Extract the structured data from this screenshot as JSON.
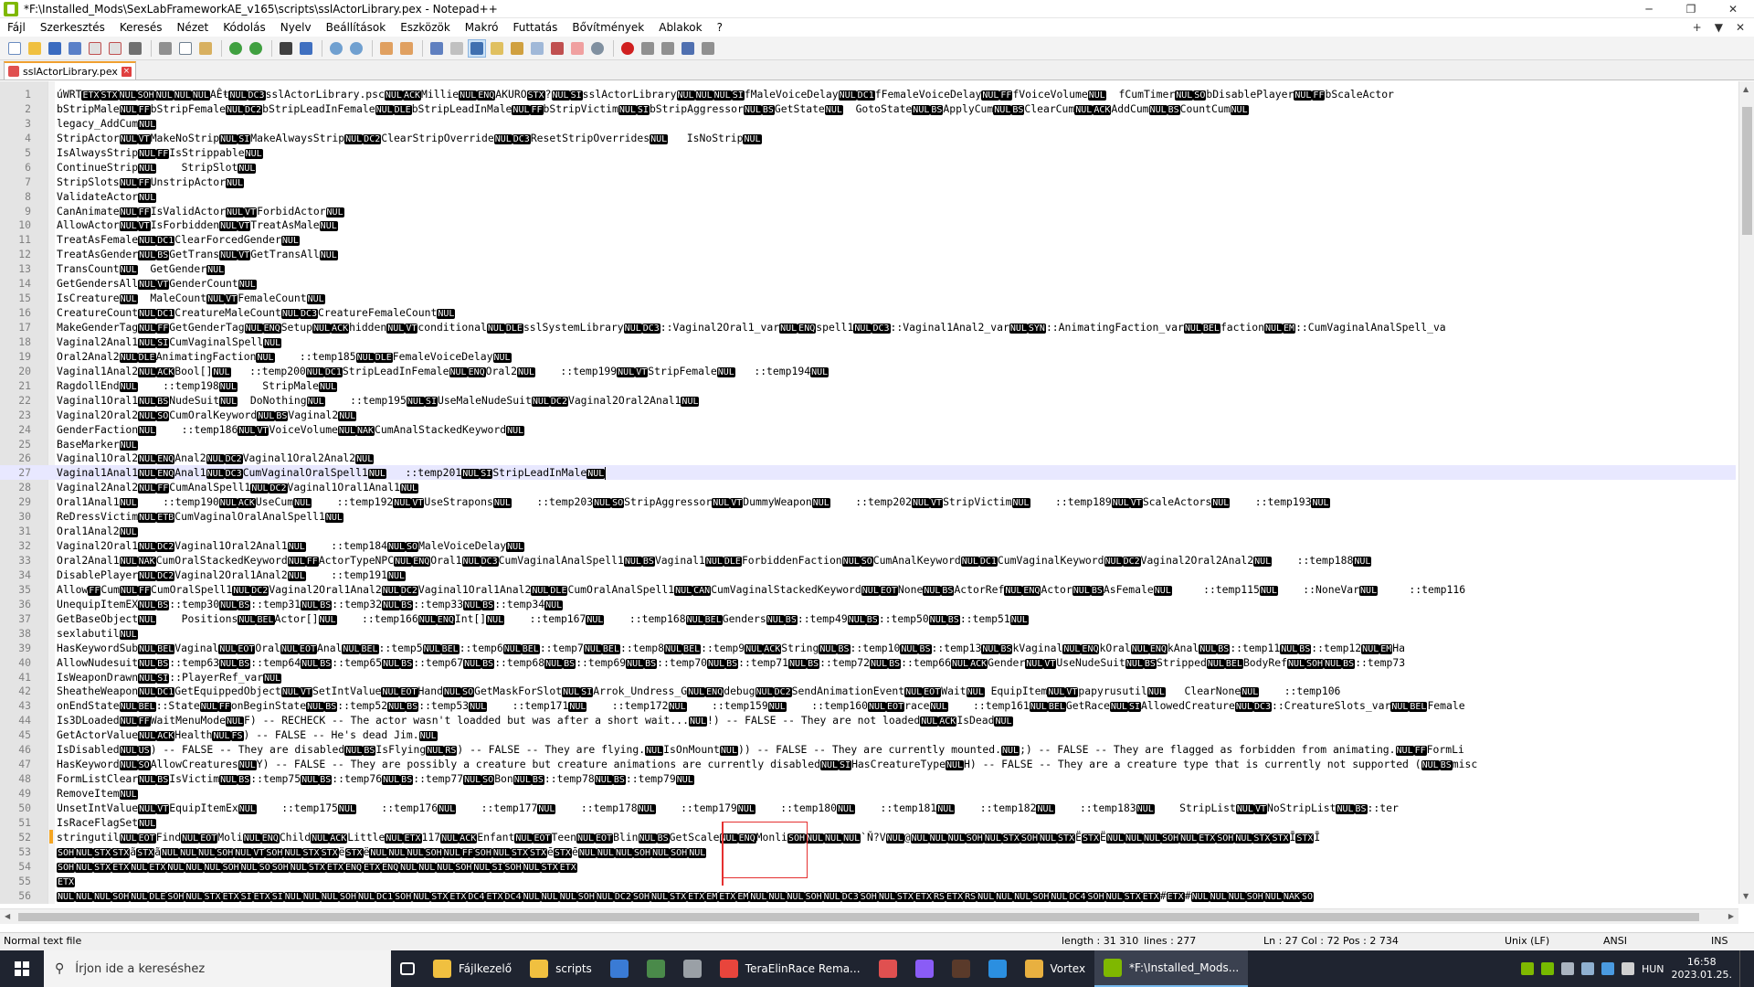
{
  "window": {
    "title": "*F:\\Installed_Mods\\SexLabFrameworkAE_v165\\scripts\\sslActorLibrary.pex - Notepad++",
    "controls": [
      "─",
      "❐",
      "✕"
    ]
  },
  "menu": {
    "items": [
      "Fájl",
      "Szerkesztés",
      "Keresés",
      "Nézet",
      "Kódolás",
      "Nyelv",
      "Beállítások",
      "Eszközök",
      "Makró",
      "Futtatás",
      "Bővítmények",
      "Ablakok",
      "?"
    ],
    "right": [
      "+",
      "▼",
      "✕"
    ]
  },
  "tab": {
    "label": "sslActorLibrary.pex",
    "close": "×"
  },
  "editor": {
    "lines": [
      {
        "n": "1",
        "t": "úWRTETXSTXNULSOHNULNULNULAÊŧNULDC3sslActorLibrary.pscNULACKMillieNULENQAKUROSTX?NULSIsslActorLibraryNULNULNULSIfMaleVoiceDelayNULDC1fFemaleVoiceDelayNULFFfVoiceVolumeNUL  fCumTimerNULSObDisablePlayerNULFFbScaleActor"
      },
      {
        "n": "2",
        "t": "bStripMaleNULFFbStripFemaleNULDC2bStripLeadInFemaleNULDLEbStripLeadInMaleNULFFbStripVictimNULSIbStripAggressorNULBSGetStateNUL  GotoStateNULBSApplyCumNULBSClearCumNULACKAddCumNULBSCountCumNUL"
      },
      {
        "n": "3",
        "t": "legacy_AddCumNUL"
      },
      {
        "n": "4",
        "t": "StripActorNULVTMakeNoStripNULSIMakeAlwaysStripNULDC2ClearStripOverrideNULDC3ResetStripOverridesNUL   IsNoStripNUL"
      },
      {
        "n": "5",
        "t": "IsAlwaysStripNULFFIsStrippableNUL"
      },
      {
        "n": "6",
        "t": "ContinueStripNUL    StripSlotNUL"
      },
      {
        "n": "7",
        "t": "StripSlotsNULFFUnstripActorNUL"
      },
      {
        "n": "8",
        "t": "ValidateActorNUL"
      },
      {
        "n": "9",
        "t": "CanAnimateNULFFIsValidActorNULVTForbidActorNUL"
      },
      {
        "n": "10",
        "t": "AllowActorNULVTIsForbiddenNULVTTreatAsMaleNUL"
      },
      {
        "n": "11",
        "t": "TreatAsFemaleNULDC1ClearForcedGenderNUL"
      },
      {
        "n": "12",
        "t": "TreatAsGenderNULBSGetTransNULVTGetTransAllNUL"
      },
      {
        "n": "13",
        "t": "TransCountNUL  GetGenderNUL"
      },
      {
        "n": "14",
        "t": "GetGendersAllNULVTGenderCountNUL"
      },
      {
        "n": "15",
        "t": "IsCreatureNUL  MaleCountNULVTFemaleCountNUL"
      },
      {
        "n": "16",
        "t": "CreatureCountNULDC1CreatureMaleCountNULDC3CreatureFemaleCountNUL"
      },
      {
        "n": "17",
        "t": "MakeGenderTagNULFFGetGenderTagNULENQSetupNULACKhiddenNULVTconditionalNULDLEsslSystemLibraryNULDC3::Vaginal2Oral1_varNULENQspell1NULDC3::Vaginal1Anal2_varNULSYN::AnimatingFaction_varNULBELfactionNULEM::CumVaginalAnalSpell_va"
      },
      {
        "n": "18",
        "t": "Vaginal2Anal1NULSICumVaginalSpellNUL"
      },
      {
        "n": "19",
        "t": "Oral2Anal2NULDLEAnimatingFactionNUL    ::temp185NULDLEFemaleVoiceDelayNUL"
      },
      {
        "n": "20",
        "t": "Vaginal1Anal2NULACKBool[]NUL   ::temp200NULDC1StripLeadInFemaleNULENQOral2NUL    ::temp199NULVTStripFemaleNUL   ::temp194NUL"
      },
      {
        "n": "21",
        "t": "RagdollEndNUL    ::temp198NUL    StripMaleNUL"
      },
      {
        "n": "22",
        "t": "Vaginal1Oral1NULBSNudeSuitNUL  DoNothingNUL    ::temp195NULSIUseMaleNudeSuitNULDC2Vaginal2Oral2Anal1NUL"
      },
      {
        "n": "23",
        "t": "Vaginal2Oral2NULSOCumOralKeywordNULBSVaginal2NUL"
      },
      {
        "n": "24",
        "t": "GenderFactionNUL    ::temp186NULVTVoiceVolumeNULNAKCumAnalStackedKeywordNUL"
      },
      {
        "n": "25",
        "t": "BaseMarkerNUL"
      },
      {
        "n": "26",
        "t": "Vaginal1Oral2NULENQAnal2NULDC2Vaginal1Oral2Anal2NUL"
      },
      {
        "n": "27",
        "t": "Vaginal1Anal1NULENQAnal1NULDC3CumVaginalOralSpell1NUL   ::temp201NULSIStripLeadInMaleNUL",
        "current": true
      },
      {
        "n": "28",
        "t": "Vaginal2Anal2NULFFCumAnalSpell1NULDC2Vaginal1Oral1Anal1NUL"
      },
      {
        "n": "29",
        "t": "Oral1Anal1NUL    ::temp190NULACKUseCumNUL    ::temp192NULVTUseStraponsNUL    ::temp203NULSOStripAggressorNULVTDummyWeaponNUL    ::temp202NULVTStripVictimNUL    ::temp189NULVTScaleActorsNUL    ::temp193NUL"
      },
      {
        "n": "30",
        "t": "ReDressVictimNULETBCumVaginalOralAnalSpell1NUL"
      },
      {
        "n": "31",
        "t": "Oral1Anal2NUL"
      },
      {
        "n": "32",
        "t": "Vaginal2Oral1NULDC2Vaginal1Oral2Anal1NUL    ::temp184NULSOMaleVoiceDelayNUL"
      },
      {
        "n": "33",
        "t": "Oral2Anal1NULNAKCumOralStackedKeywordNULFFActorTypeNPCNULENQOral1NULDC3CumVaginalAnalSpell1NULBSVaginal1NULDLEForbiddenFactionNULSOCumAnalKeywordNULDC1CumVaginalKeywordNULDC2Vaginal2Oral2Anal2NUL    ::temp188NUL"
      },
      {
        "n": "34",
        "t": "DisablePlayerNULDC2Vaginal2Oral1Anal2NUL    ::temp191NUL"
      },
      {
        "n": "35",
        "t": "AllowFFCumNULFFCumOralSpell1NULDC2Vaginal2Oral1Anal2NULDC2Vaginal1Oral1Anal2NULDLECumOralAnalSpell1NULCANCumVaginalStackedKeywordNULEOTNoneNULBSActorRefNULENQActorNULBSAsFemaleNUL     ::temp115NUL    ::NoneVarNUL     ::temp116"
      },
      {
        "n": "36",
        "t": "UnequipItemEXNULBS::temp30NULBS::temp31NULBS::temp32NULBS::temp33NULBS::temp34NUL"
      },
      {
        "n": "37",
        "t": "GetBaseObjectNUL    PositionsNULBELActor[]NUL    ::temp166NULENQInt[]NUL    ::temp167NUL    ::temp168NULBELGendersNULBS::temp49NULBS::temp50NULBS::temp51NUL"
      },
      {
        "n": "38",
        "t": "sexlabutilNUL"
      },
      {
        "n": "39",
        "t": "HasKeywordSubNULBELVaginalNULEOTOralNULEOTAnalNULBEL::temp5NULBEL::temp6NULBEL::temp7NULBEL::temp8NULBEL::temp9NULACKStringNULBS::temp10NULBS::temp13NULBSkVaginalNULENQkOralNULENQkAnalNULBS::temp11NULBS::temp12NULEMHa"
      },
      {
        "n": "40",
        "t": "AllowNudesuitNULBS::temp63NULBS::temp64NULBS::temp65NULBS::temp67NULBS::temp68NULBS::temp69NULBS::temp70NULBS::temp71NULBS::temp72NULBS::temp66NULACKGenderNULVTUseNudeSuitNULBSStrippedNULBELBodyRefNULSOHNULBS::temp73"
      },
      {
        "n": "41",
        "t": "IsWeaponDrawnNULSI::PlayerRef_varNUL"
      },
      {
        "n": "42",
        "t": "SheatheWeaponNULDC1GetEquippedObjectNULVTSetIntValueNULEOTHandNULSOGetMaskForSlotNULSIArrok_Undress_GNULENQdebugNULDC2SendAnimationEventNULEOTWaitNUL EquipItemNULVTpapyrusutilNUL   ClearNoneNUL    ::temp106"
      },
      {
        "n": "43",
        "t": "onEndStateNULBEL::StateNULFFonBeginStateNULBS::temp52NULBS::temp53NUL    ::temp171NUL    ::temp172NUL    ::temp159NUL    ::temp160NULEOTraceNUL    ::temp161NULBELGetRaceNULSIAllowedCreatureNULDC3::CreatureSlots_varNULBELFemale"
      },
      {
        "n": "44",
        "t": "Is3DLoadedNULFFWaitMenuModeNULF) -- RECHECK -- The actor wasn't loadded but was after a short wait...NUL!) -- FALSE -- They are not loadedNULACKIsDeadNUL"
      },
      {
        "n": "45",
        "t": "GetActorValueNULACKHealthNULFS) -- FALSE -- He's dead Jim.NUL"
      },
      {
        "n": "46",
        "t": "IsDisabledNULUS) -- FALSE -- They are disabledNULBSIsFlyingNULRS) -- FALSE -- They are flying.NULIsOnMountNUL)) -- FALSE -- They are currently mounted.NUL;) -- FALSE -- They are flagged as forbidden from animating.NULFFFormLi"
      },
      {
        "n": "47",
        "t": "HasKeywordNULSOAllowCreaturesNULY) -- FALSE -- They are possibly a creature but creature animations are currently disabledNULSIHasCreatureTypeNULH) -- FALSE -- They are a creature type that is currently not supported (NULBSmisc"
      },
      {
        "n": "48",
        "t": "FormListClearNULBSIsVictimNULBS::temp75NULBS::temp76NULBS::temp77NULSOBonNULBS::temp78NULBS::temp79NUL"
      },
      {
        "n": "49",
        "t": "RemoveItemNUL"
      },
      {
        "n": "50",
        "t": "UnsetIntValueNULVTEquipItemExNUL    ::temp175NUL    ::temp176NUL    ::temp177NUL    ::temp178NUL    ::temp179NUL    ::temp180NUL    ::temp181NUL    ::temp182NUL    ::temp183NUL    StripListNULVTNoStripListNULBS::ter"
      },
      {
        "n": "51",
        "t": "IsRaceFlagSetNUL"
      },
      {
        "n": "52",
        "t": "stringutilNULEOTFindNULEOTMoliNULENQChildNULACKLittleNULETX117NULACKEnfantNULEOTTeenNULEOTBlinNULBSGetScaleNULENQMonliSOHNULNULNUL`Ň?VNUL@NULNULNULSOHNULSTXSOHNULSTXËSTXËNULNULNULSOHNULETXSOHNULSTXSTXĪSTXĪ",
        "changed": true
      },
      {
        "n": "53",
        "t": "SOHNULSTXSTXãSTXãNULNULNULSOHNULVTSOHNULSTXSTXëSTXëNULNULNULSOHNULFFSOHNULSTXSTXēSTXēNULNULNULSOHNULSOHNUL"
      },
      {
        "n": "54",
        "t": "SOHNULSTXETXNULETXNULNULNULSOHNULSOSOHNULSTXETXENQETXENQNULNULNULSOHNULSISOHNULSTXETX"
      },
      {
        "n": "55",
        "t": "ETX"
      },
      {
        "n": "56",
        "t": "NULNULNULSOHNULDLESOHNULSTXETXSIETXSINULNULNULSOHNULDC1SOHNULSTXETXDC4ETXDC4NULNULNULSOHNULDC2SOHNULSTXETXEMETXEMNULNULNULSOHNULDC3SOHNULSTXETXRSETXRSNULNULNULSOHNULDC4SOHNULSTXETX#ETX#NULNULNULSOHNULNAKSO"
      }
    ]
  },
  "status": {
    "type": "Normal text file",
    "length": "length : 31 310",
    "lines": "lines : 277",
    "position": "Ln : 27    Col : 72    Pos : 2 734",
    "eol": "Unix (LF)",
    "encoding": "ANSI",
    "mode": "INS"
  },
  "taskbar": {
    "search_placeholder": "Írjon ide a kereséshez",
    "apps": [
      {
        "label": "Fájlkezelő",
        "color": "#f0c040"
      },
      {
        "label": "scripts",
        "color": "#f0c040"
      },
      {
        "label": "",
        "color": "#3a7bd5"
      },
      {
        "label": "",
        "color": "#4a8a4a"
      },
      {
        "label": "",
        "color": "#9aa0a6"
      },
      {
        "label": "TeraElinRace Rema...",
        "color": "#e8453c"
      },
      {
        "label": "",
        "color": "#e05050"
      },
      {
        "label": "",
        "color": "#8a5cf6"
      },
      {
        "label": "",
        "color": "#5a3a2a"
      },
      {
        "label": "",
        "color": "#2b8fe0"
      },
      {
        "label": "Vortex",
        "color": "#e8b040"
      },
      {
        "label": "*F:\\Installed_Mods...",
        "color": "#7fb800"
      }
    ],
    "lang": "HUN",
    "time": "16:58",
    "date": "2023.01.25."
  },
  "colors": {
    "accent": "#f0a030",
    "current_line": "#e8e8ff",
    "annotation": "#e53030"
  }
}
